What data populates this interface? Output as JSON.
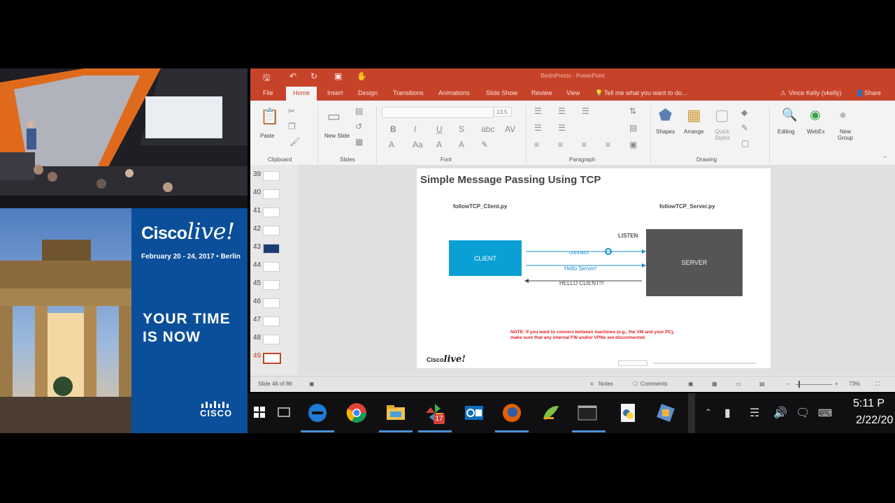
{
  "event": {
    "brand_cisco": "Cisco",
    "brand_live": "live!",
    "dates": "February 20 - 24, 2017 • Berlin",
    "tagline_1": "YOUR TIME",
    "tagline_2": "IS NOW",
    "footer_brand": "CISCO"
  },
  "window": {
    "title": "BerlinPresto - PowerPoint",
    "user": "Vince Kelly (vkelly)",
    "share": "Share"
  },
  "tabs": [
    "File",
    "Home",
    "Insert",
    "Design",
    "Transitions",
    "Animations",
    "Slide Show",
    "Review",
    "View"
  ],
  "tell_me": "Tell me what you want to do...",
  "ribbon": {
    "paste": "Paste",
    "new_slide": "New Slide",
    "font_size": "13.5",
    "shapes": "Shapes",
    "arrange": "Arrange",
    "quick_styles": "Quick Styles",
    "editing": "Editing",
    "webex": "WebEx",
    "new_group": "New Group",
    "groups": {
      "clipboard": "Clipboard",
      "slides": "Slides",
      "font": "Font",
      "paragraph": "Paragraph",
      "drawing": "Drawing"
    }
  },
  "thumbnails": [
    "39",
    "40",
    "41",
    "42",
    "43",
    "44",
    "45",
    "46",
    "47",
    "48",
    "49"
  ],
  "slide": {
    "title": "Simple Message Passing Using TCP",
    "client_file": "followTCP_Client.py",
    "server_file": "followTCP_Server.py",
    "client_label": "CLIENT",
    "server_label": "SERVER",
    "listen": "LISTEN",
    "connect": "connect",
    "hello_server": "Hello Server!",
    "hello_client": "HELLO CLIENT!!!",
    "note_1": "NOTE: If you want to connect between machines (e.g., the VM and your PC),",
    "note_2": "make sure that any internal FW and/or VPNs are disconnected.",
    "footer_logo_cisco": "Cisco",
    "footer_logo_live": "live!"
  },
  "status": {
    "slide_info": "Slide 46 of 86",
    "notes": "Notes",
    "comments": "Comments",
    "zoom": "73%"
  },
  "taskbar": {
    "outlook_badge": "17",
    "time": "5:11 P",
    "date": "2/22/20"
  },
  "colors": {
    "ppt_accent": "#c6432a",
    "cisco_blue": "#0b4f9a",
    "client_box": "#0aa0d6",
    "server_box": "#555555",
    "note_red": "#e02020"
  }
}
